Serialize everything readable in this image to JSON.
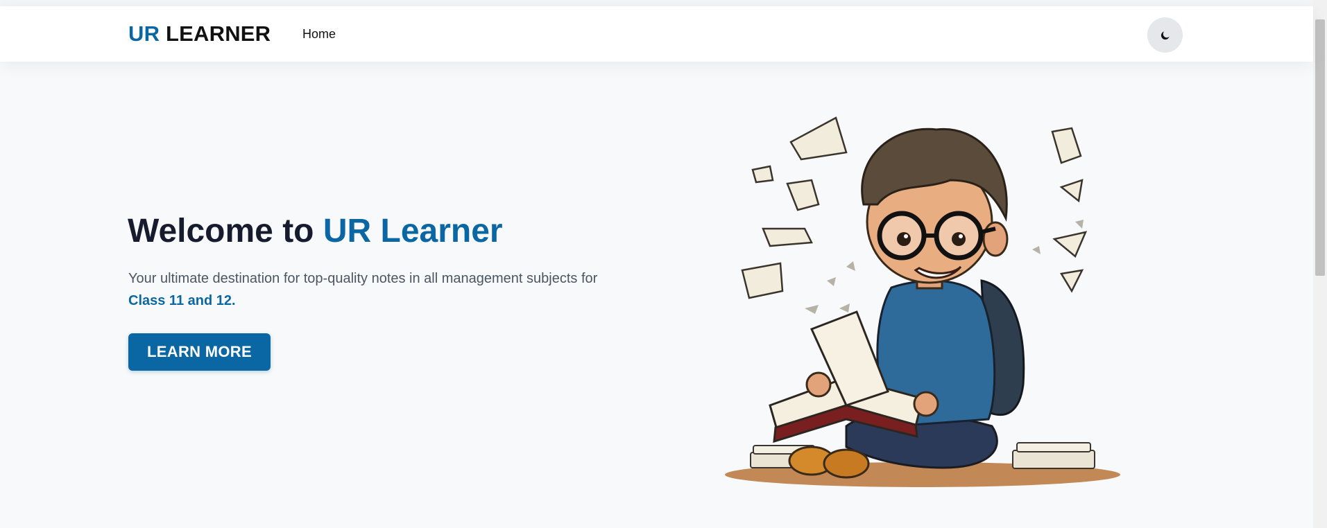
{
  "navbar": {
    "logo_part1": "UR",
    "logo_part2": "LEARNER",
    "links": [
      {
        "label": "Home"
      }
    ],
    "theme_toggle_icon": "moon-icon"
  },
  "hero": {
    "title_part1": "Welcome to",
    "title_part2": "UR Learner",
    "description": "Your ultimate destination for top-quality notes in all management subjects for",
    "description_highlight": "Class 11 and 12.",
    "cta_label": "LEARN MORE",
    "illustration": "boy-reading-book-illustration"
  },
  "colors": {
    "accent": "#0a67a3",
    "heading": "#161c2d",
    "body_text": "#4b5563",
    "background": "#f8f9fa"
  }
}
